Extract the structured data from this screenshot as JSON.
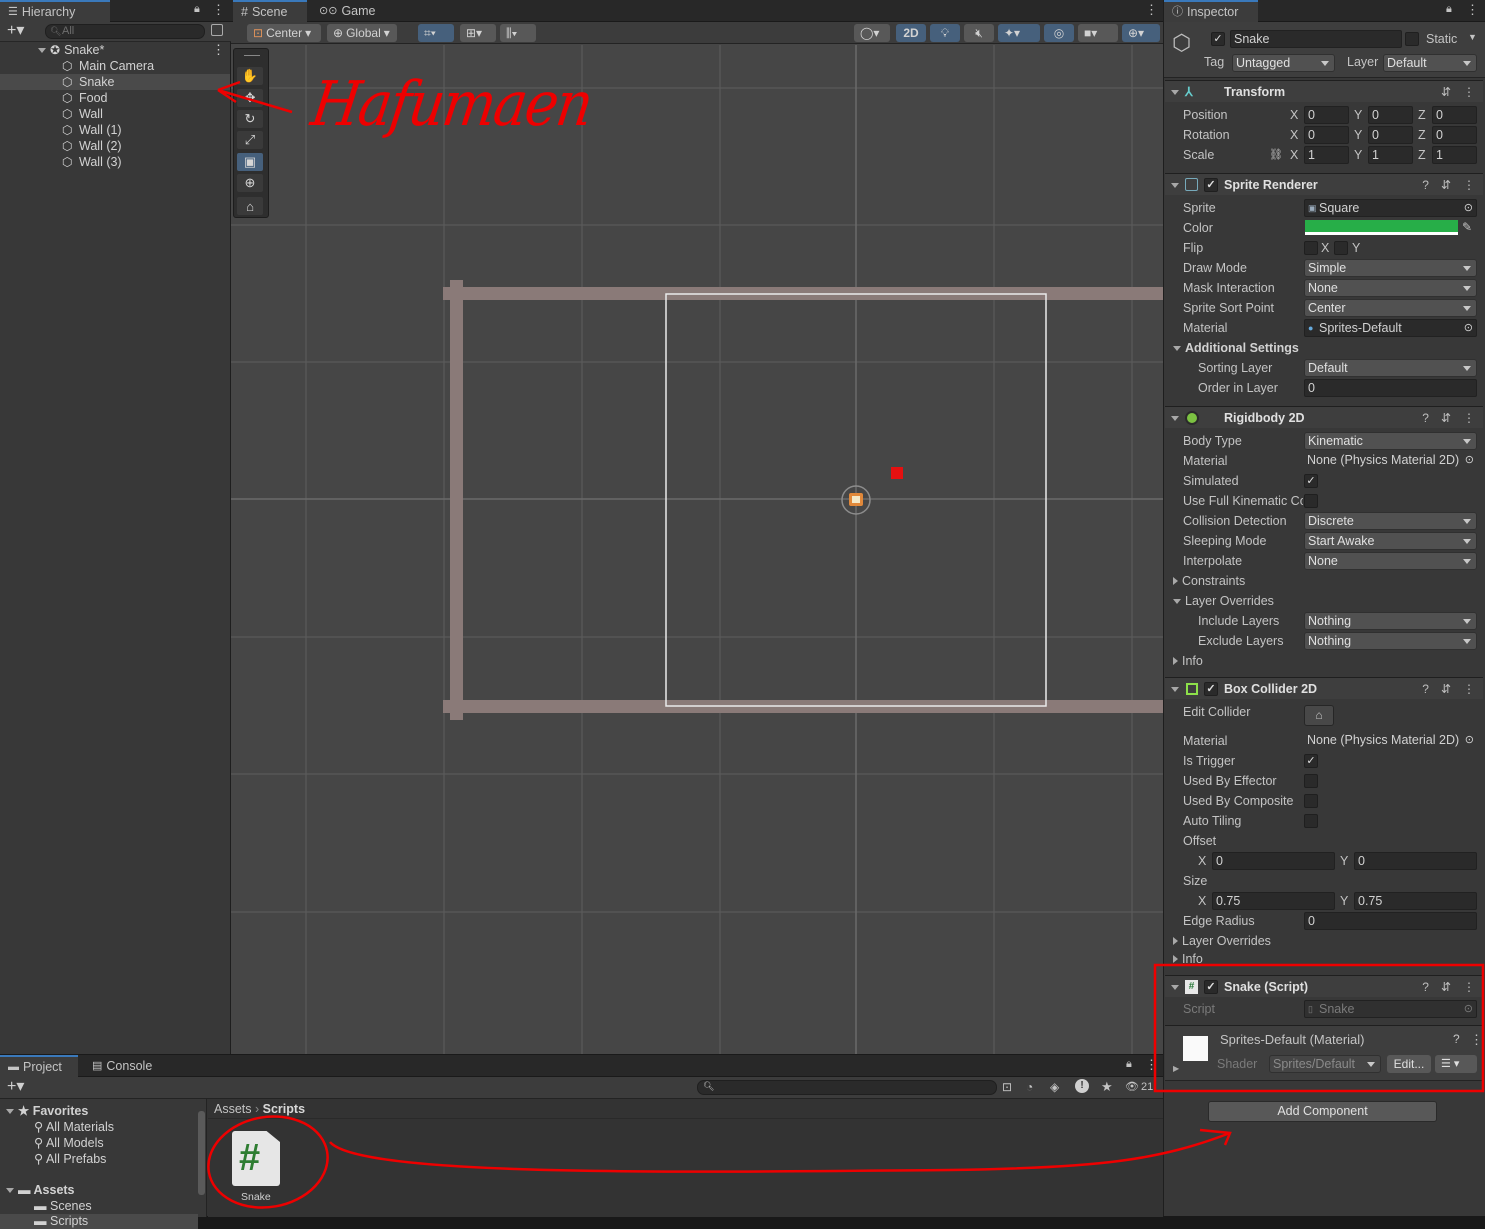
{
  "hierarchy": {
    "tab_label": "Hierarchy",
    "search_placeholder": "All",
    "scene_name": "Snake*",
    "items": [
      "Main Camera",
      "Snake",
      "Food",
      "Wall",
      "Wall (1)",
      "Wall (2)",
      "Wall (3)"
    ],
    "selected_index": 1
  },
  "scene_view": {
    "tabs": [
      "Scene",
      "Game"
    ],
    "pivot_mode": "Center",
    "pivot_rotation": "Global",
    "mode_2d_label": "2D",
    "tools": [
      "hand-tool",
      "move-tool",
      "rotate-tool",
      "scale-tool",
      "rect-tool",
      "transform-tool",
      "custom-tool"
    ],
    "active_tool": "rect-tool"
  },
  "inspector": {
    "tab_label": "Inspector",
    "object_name": "Snake",
    "static_label": "Static",
    "tag_label": "Tag",
    "tag_value": "Untagged",
    "layer_label": "Layer",
    "layer_value": "Default",
    "transform": {
      "title": "Transform",
      "position_label": "Position",
      "rotation_label": "Rotation",
      "scale_label": "Scale",
      "position": [
        "0",
        "0",
        "0"
      ],
      "rotation": [
        "0",
        "0",
        "0"
      ],
      "scale": [
        "1",
        "1",
        "1"
      ],
      "axis_labels": [
        "X",
        "Y",
        "Z"
      ]
    },
    "sprite_renderer": {
      "title": "Sprite Renderer",
      "sprite_label": "Sprite",
      "sprite_value": "Square",
      "color_label": "Color",
      "color_value": "#27ae48",
      "flip_label": "Flip",
      "flip_x": "X",
      "flip_y": "Y",
      "draw_mode_label": "Draw Mode",
      "draw_mode_value": "Simple",
      "mask_label": "Mask Interaction",
      "mask_value": "None",
      "sort_point_label": "Sprite Sort Point",
      "sort_point_value": "Center",
      "material_label": "Material",
      "material_value": "Sprites-Default",
      "additional_label": "Additional Settings",
      "sorting_layer_label": "Sorting Layer",
      "sorting_layer_value": "Default",
      "order_label": "Order in Layer",
      "order_value": "0"
    },
    "rigidbody": {
      "title": "Rigidbody 2D",
      "body_type_label": "Body Type",
      "body_type_value": "Kinematic",
      "material_label": "Material",
      "material_value": "None (Physics Material 2D)",
      "simulated_label": "Simulated",
      "full_kinematic_label": "Use Full Kinematic Co",
      "collision_label": "Collision Detection",
      "collision_value": "Discrete",
      "sleeping_label": "Sleeping Mode",
      "sleeping_value": "Start Awake",
      "interpolate_label": "Interpolate",
      "interpolate_value": "None",
      "constraints_label": "Constraints",
      "layer_overrides_label": "Layer Overrides",
      "include_label": "Include Layers",
      "include_value": "Nothing",
      "exclude_label": "Exclude Layers",
      "exclude_value": "Nothing",
      "info_label": "Info"
    },
    "box_collider": {
      "title": "Box Collider 2D",
      "edit_label": "Edit Collider",
      "material_label": "Material",
      "material_value": "None (Physics Material 2D)",
      "trigger_label": "Is Trigger",
      "effector_label": "Used By Effector",
      "composite_label": "Used By Composite",
      "tiling_label": "Auto Tiling",
      "offset_label": "Offset",
      "offset_x": "0",
      "offset_y": "0",
      "size_label": "Size",
      "size_x": "0.75",
      "size_y": "0.75",
      "edge_label": "Edge Radius",
      "edge_value": "0",
      "layer_overrides_label": "Layer Overrides",
      "info_label": "Info"
    },
    "script": {
      "title": "Snake (Script)",
      "script_label": "Script",
      "script_value": "Snake"
    },
    "material": {
      "title": "Sprites-Default (Material)",
      "shader_label": "Shader",
      "shader_value": "Sprites/Default",
      "edit_label": "Edit..."
    },
    "add_component_label": "Add Component"
  },
  "project": {
    "tabs": [
      "Project",
      "Console"
    ],
    "favorites_label": "Favorites",
    "favorites": [
      "All Materials",
      "All Models",
      "All Prefabs"
    ],
    "assets_label": "Assets",
    "asset_folders": [
      "Scenes",
      "Scripts"
    ],
    "breadcrumb": [
      "Assets",
      "Scripts"
    ],
    "files": [
      {
        "name": "Snake",
        "icon": "csharp-script-icon"
      }
    ],
    "hidden_count": "21"
  },
  "annotation_text": "Hafumaen"
}
